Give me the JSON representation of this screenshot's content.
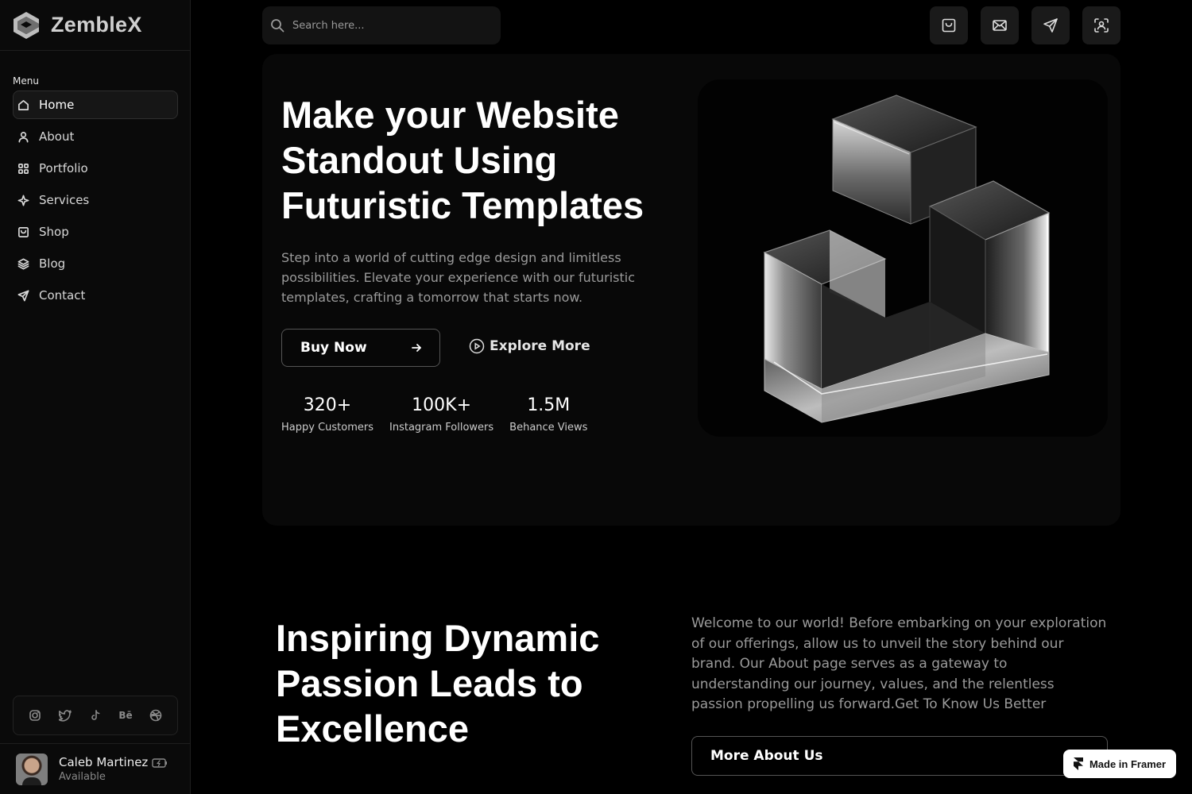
{
  "brand": {
    "name": "ZembleX"
  },
  "sidebar": {
    "menu_label": "Menu",
    "items": [
      {
        "label": "Home",
        "icon": "home-icon",
        "active": true
      },
      {
        "label": "About",
        "icon": "user-icon"
      },
      {
        "label": "Portfolio",
        "icon": "grid-icon"
      },
      {
        "label": "Services",
        "icon": "sparkle-icon"
      },
      {
        "label": "Shop",
        "icon": "shop-icon"
      },
      {
        "label": "Blog",
        "icon": "layers-icon"
      },
      {
        "label": "Contact",
        "icon": "send-icon"
      }
    ],
    "socials": [
      "instagram-icon",
      "twitter-icon",
      "tiktok-icon",
      "behance-icon",
      "dribbble-icon"
    ],
    "behance_text": "Bē",
    "user": {
      "name": "Caleb Martinez",
      "status": "Available"
    }
  },
  "topbar": {
    "search_placeholder": "Search here...",
    "buttons": [
      "shop-icon",
      "mail-icon",
      "send-icon",
      "scan-icon"
    ]
  },
  "hero": {
    "title": "Make your Website\nStandout Using\nFuturistic  Templates",
    "description": "Step into a world of cutting edge design and limitless possibilities. Elevate your experience with our futuristic templates, crafting a tomorrow that starts now.",
    "buy_label": "Buy Now",
    "explore_label": "Explore More",
    "stats": [
      {
        "value": "320+",
        "label": "Happy Customers"
      },
      {
        "value": "100K+",
        "label": "Instagram Followers"
      },
      {
        "value": "1.5M",
        "label": "Behance Views"
      }
    ]
  },
  "about": {
    "title": "Inspiring Dynamic\nPassion Leads to\nExcellence",
    "text": "Welcome to our world! Before embarking on your exploration of our offerings, allow us to unveil the story behind our brand. Our About page serves as a gateway to understanding our journey, values, and the relentless passion propelling us forward.Get To Know Us Better",
    "button_label": "More About Us"
  },
  "badge": {
    "label": "Made in Framer"
  }
}
